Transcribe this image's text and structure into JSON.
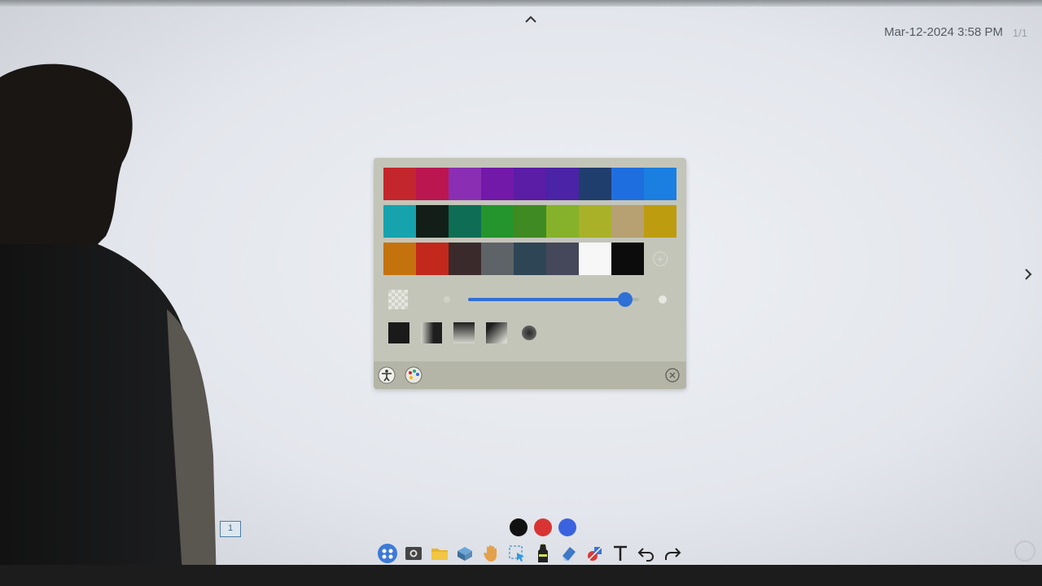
{
  "header": {
    "datetime": "Mar-12-2024 3:58 PM",
    "page_count": "1/1"
  },
  "palette": {
    "rows": [
      [
        "#c4262d",
        "#bb1650",
        "#8a2fb3",
        "#7219a9",
        "#5b1ca6",
        "#4a23a6",
        "#1f3e6d",
        "#1f6ee0",
        "#1a7fe0"
      ],
      [
        "#16a3ae",
        "#121e17",
        "#0e6e55",
        "#24942c",
        "#3f8a22",
        "#86b12a",
        "#a9b129",
        "#b7a071",
        "#bd9c10"
      ],
      [
        "#c4720e",
        "#c3281d",
        "#3a2a2b",
        "#5e6367",
        "#2e4556",
        "#44485a",
        "#f7f7f7",
        "#0c0c0c"
      ]
    ],
    "add_color_icon": "plus-circle-icon",
    "opacity": 0.92,
    "brushes": [
      "solid-brush",
      "fade-right-brush",
      "fade-down-brush",
      "fade-diagonal-brush",
      "soft-round-brush"
    ],
    "footer_icons": [
      "accessibility-icon",
      "palette-icon"
    ],
    "close_icon": "close-circle-icon",
    "accent_color": "#2f6fd6"
  },
  "quick_colors": [
    "#111111",
    "#d93434",
    "#3b63e0"
  ],
  "toolbar": {
    "tools": [
      "apps-icon",
      "screenshot-icon",
      "folder-icon",
      "toolbox-icon",
      "hand-icon",
      "select-icon",
      "pen-icon",
      "eraser-icon",
      "shapes-icon",
      "text-icon",
      "undo-icon",
      "redo-icon"
    ]
  },
  "page_thumbnail": "1"
}
